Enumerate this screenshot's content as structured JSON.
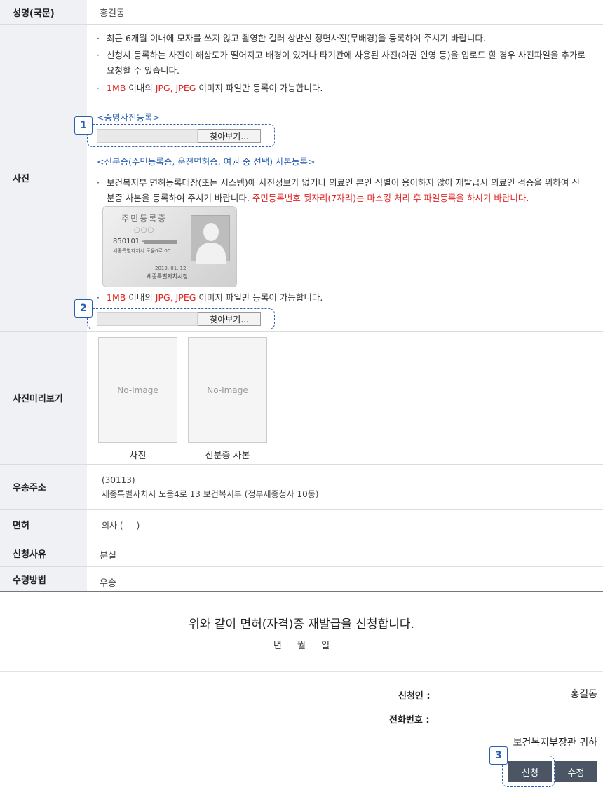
{
  "rows": {
    "name": {
      "label": "성명(국문)",
      "value": "홍길동"
    },
    "photo": {
      "label": "사진",
      "bullets": [
        "최근 6개월 이내에 모자를 쓰지 않고 촬영한 컬러 상반신 정면사진(무배경)을 등록하여 주시기 바랍니다.",
        "신청시 등록하는 사진이 해상도가 떨어지고 배경이 있거나 타기관에 사용된 사진(여권 인영 등)을 업로드 할 경우 사진파일을 추가로",
        "요청할 수 있습니다."
      ],
      "size_note": {
        "size": "1MB",
        "mid": " 이내의 ",
        "formats": "JPG, JPEG",
        "rest": " 이미지 파일만 등록이 가능합니다."
      },
      "id_photo_title": "<증명사진등록>",
      "id_copy_title": "<신분증(주민등록증, 운전면허증, 여권 중 선택) 사본등록>",
      "id_copy_bullet_1": "보건복지부 면허등록대장(또는 시스템)에 사진정보가 없거나 의료인 본인 식별이 용이하지 않아 재발급시 의료인 검증을 위하여 신",
      "id_copy_bullet_2a": "분증 사본을 등록하여 주시기 바랍니다. ",
      "id_copy_bullet_2b": "주민등록번호 뒷자리(7자리)는 마스킹 처리 후 파일등록을 하시기 바랍니다.",
      "browse_label": "찾아보기...",
      "card": {
        "title": "주민등록증",
        "circles": "○○○",
        "number": "850101 -",
        "address": "세종특별자치시 도움0로 00",
        "date": "2019. 01. 12.",
        "issuer": "세종특별자치시장"
      }
    },
    "preview": {
      "label": "사진미리보기",
      "placeholder": "No-Image",
      "caption_photo": "사진",
      "caption_id": "신분증 사본"
    },
    "address": {
      "label": "우송주소",
      "zip": "(30113)",
      "line": "세종특별자치시 도움4로 13 보건복지부 (정부세종청사 10동)"
    },
    "license": {
      "label": "면허",
      "value": "의사 (     )"
    },
    "reason": {
      "label": "신청사유",
      "value": "분실"
    },
    "receive": {
      "label": "수령방법",
      "value": "우송"
    }
  },
  "callouts": [
    "1",
    "2",
    "3"
  ],
  "statement": "위와 같이 면허(자격)증 재발급을 신청합니다.",
  "date_line": "년 월 일",
  "applicant": {
    "label": "신청인 :",
    "value": "홍길동"
  },
  "phone": {
    "label": "전화번호 :",
    "value": ""
  },
  "addressee": "보건복지부장관 귀하",
  "buttons": {
    "apply": "신청",
    "edit": "수정"
  },
  "colors": {
    "accent": "#2a5fb0",
    "alert": "#e02323",
    "button": "#4b5563",
    "header_bg": "#eff1f5"
  }
}
